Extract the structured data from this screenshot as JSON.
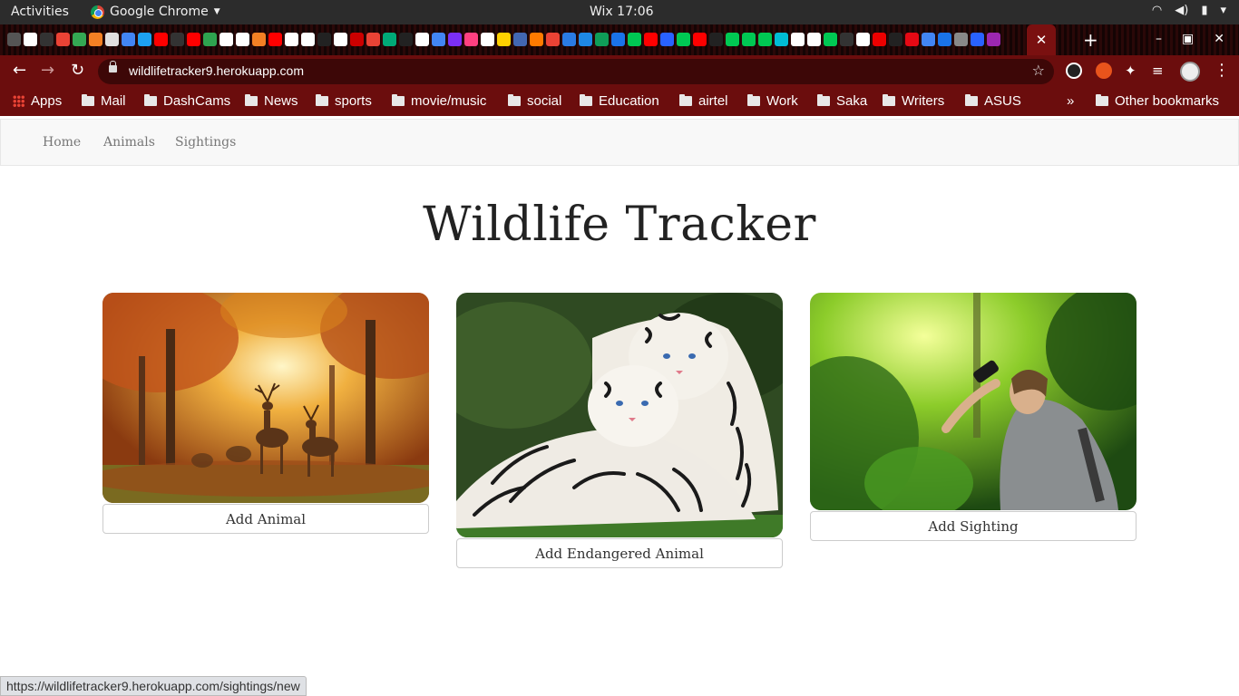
{
  "os_bar": {
    "activities": "Activities",
    "app_name": "Google Chrome",
    "clock": "Wix 17:06"
  },
  "browser": {
    "url": "wildlifetracker9.herokuapp.com",
    "bookmarks": [
      "Apps",
      "Mail",
      "DashCams",
      "News",
      "sports",
      "movie/music",
      "social",
      "Education",
      "airtel",
      "Work",
      "Saka",
      "Writers",
      "ASUS"
    ],
    "overflow": "»",
    "other_bookmarks": "Other bookmarks"
  },
  "nav": {
    "home": "Home",
    "animals": "Animals",
    "sightings": "Sightings"
  },
  "page": {
    "title": "Wildlife Tracker"
  },
  "cards": [
    {
      "button": "Add Animal",
      "image": "deer-in-autumn-forest"
    },
    {
      "button": "Add Endangered Animal",
      "image": "white-tigers"
    },
    {
      "button": "Add Sighting",
      "image": "birdwatcher-with-binoculars"
    }
  ],
  "status": {
    "hover_url": "https://wildlifetracker9.herokuapp.com/sightings/new"
  }
}
